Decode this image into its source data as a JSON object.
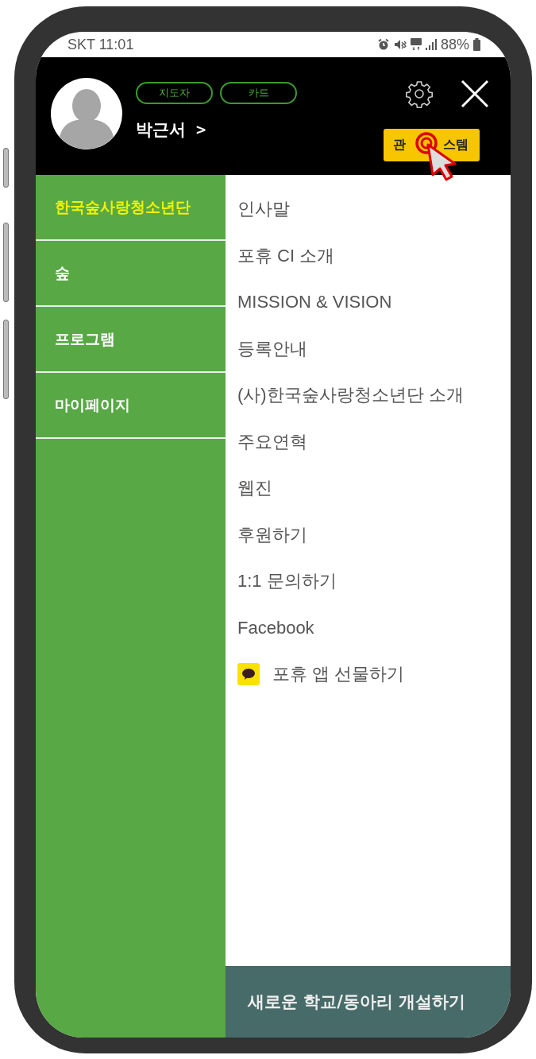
{
  "status_bar": {
    "carrier_time": "SKT 11:01",
    "battery": "88%"
  },
  "header": {
    "badges": [
      "지도자",
      "카드"
    ],
    "user_name": "박근서",
    "user_arrow": ">",
    "admin_button": [
      "관",
      "스템"
    ]
  },
  "menu": [
    {
      "label": "한국숲사랑청소년단",
      "selected": true
    },
    {
      "label": "숲",
      "selected": false
    },
    {
      "label": "프로그램",
      "selected": false
    },
    {
      "label": "마이페이지",
      "selected": false
    }
  ],
  "submenu": [
    {
      "label": "인사말",
      "kind": "text"
    },
    {
      "label": "포휴 CI 소개",
      "kind": "text"
    },
    {
      "label": "MISSION & VISION",
      "kind": "text"
    },
    {
      "label": "등록안내",
      "kind": "text"
    },
    {
      "label": "(사)한국숲사랑청소년단 소개",
      "kind": "text"
    },
    {
      "label": "주요연혁",
      "kind": "text"
    },
    {
      "label": "웹진",
      "kind": "text"
    },
    {
      "label": "후원하기",
      "kind": "text"
    },
    {
      "label": "1:1 문의하기",
      "kind": "text"
    },
    {
      "label": "Facebook",
      "kind": "text"
    },
    {
      "label": "포휴 앱 선물하기",
      "kind": "kakao"
    }
  ],
  "create_button": "새로운 학교/동아리 개설하기"
}
